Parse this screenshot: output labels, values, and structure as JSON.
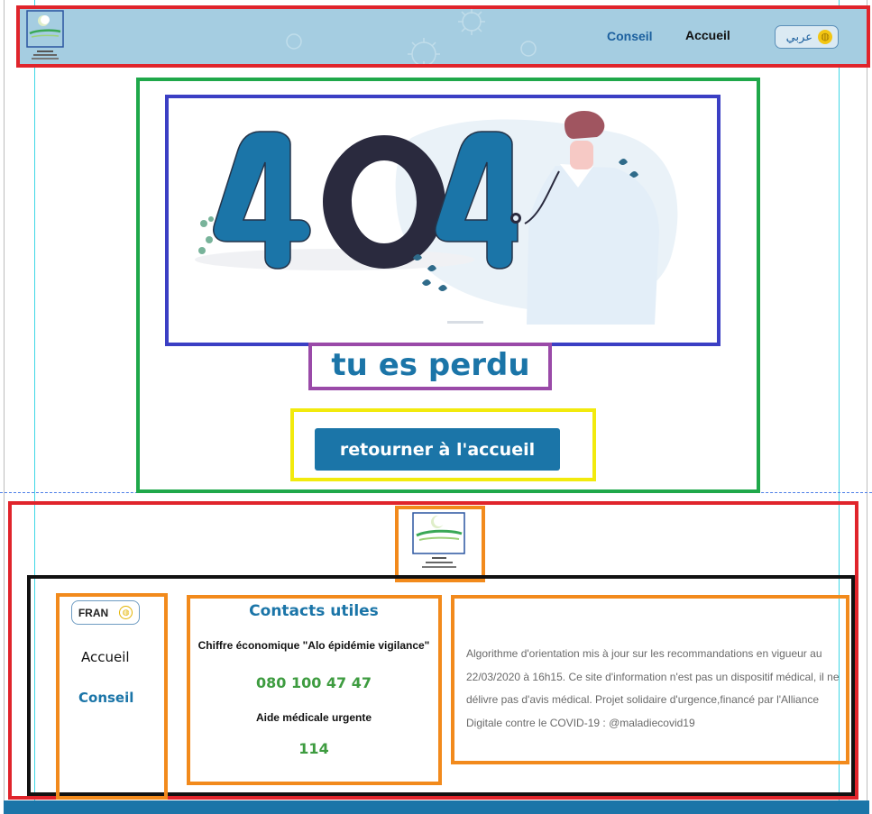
{
  "header": {
    "logo_icon": "ministry-logo",
    "nav": [
      {
        "label": "Conseil"
      },
      {
        "label": "Accueil"
      }
    ],
    "language_button": {
      "label": "عربي",
      "icon": "globe-icon"
    }
  },
  "main": {
    "illustration_icon": "404-doctor-illustration",
    "illustration_text": "404",
    "message": "tu es perdu",
    "home_button": "retourner à l'accueil"
  },
  "footer": {
    "logo_icon": "ministry-logo",
    "language_button": {
      "label": "FRAN",
      "icon": "globe-icon"
    },
    "links": [
      {
        "label": "Accueil"
      },
      {
        "label": "Conseil"
      }
    ],
    "contacts": {
      "title": "Contacts utiles",
      "items": [
        {
          "label": "Chiffre économique \"Alo épidémie vigilance\"",
          "number": "080 100 47 47"
        },
        {
          "label": "Aide médicale urgente",
          "number": "114"
        }
      ]
    },
    "disclaimer": "Algorithme d'orientation mis à jour sur les recommandations en vigueur au 22/03/2020 à 16h15.  Ce site d'information n'est pas un dispositif médical, il ne délivre pas d'avis médical. Projet solidaire d'urgence,financé par l'Alliance Digitale contre le COVID-19 : @maladiecovid19"
  },
  "colors": {
    "primary": "#1b75a8",
    "header_bg": "#a5cde1",
    "number_green": "#3e9c40",
    "annotation_red": "#e0242b",
    "annotation_green": "#1fa84a",
    "annotation_blue": "#3b3fc4",
    "annotation_purple": "#9a4aa8",
    "annotation_yellow": "#f2ea0d",
    "annotation_orange": "#f28a1c",
    "annotation_black": "#111111"
  }
}
